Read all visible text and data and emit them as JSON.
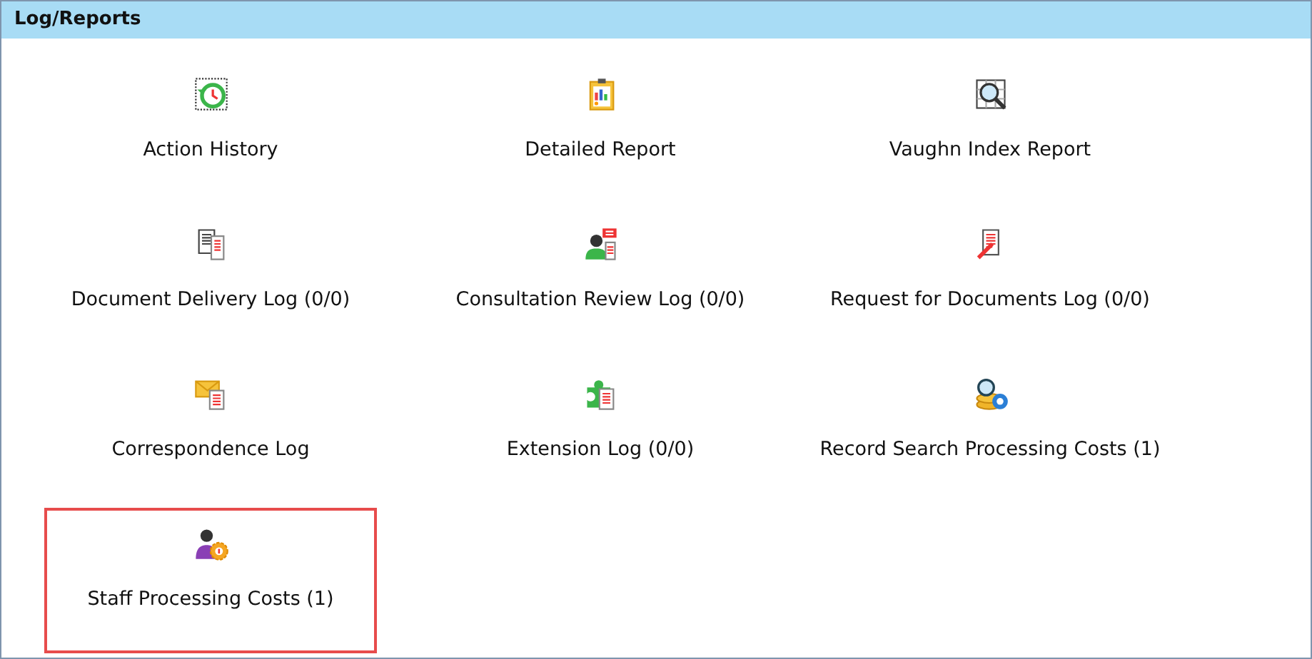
{
  "panel": {
    "title": "Log/Reports"
  },
  "items": [
    {
      "label": "Action History",
      "kind": "history",
      "highlighted": false
    },
    {
      "label": "Detailed Report",
      "kind": "report",
      "highlighted": false
    },
    {
      "label": "Vaughn Index Report",
      "kind": "index",
      "highlighted": false
    },
    {
      "label": "Document Delivery Log (0/0)",
      "kind": "delivery",
      "highlighted": false
    },
    {
      "label": "Consultation Review Log (0/0)",
      "kind": "consultation",
      "highlighted": false
    },
    {
      "label": "Request for Documents Log (0/0)",
      "kind": "request",
      "highlighted": false
    },
    {
      "label": "Correspondence Log",
      "kind": "correspondence",
      "highlighted": false
    },
    {
      "label": "Extension Log (0/0)",
      "kind": "extension",
      "highlighted": false
    },
    {
      "label": "Record Search Processing Costs (1)",
      "kind": "search-costs",
      "highlighted": false
    },
    {
      "label": "Staff Processing Costs (1)",
      "kind": "staff-costs",
      "highlighted": true
    }
  ]
}
